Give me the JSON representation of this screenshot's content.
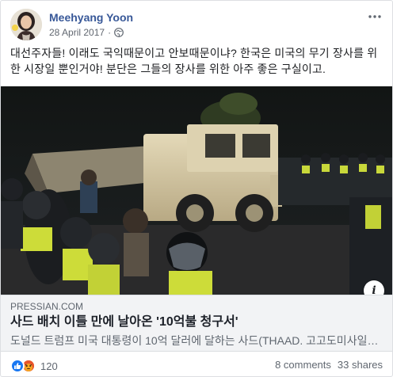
{
  "post": {
    "author": "Meehyang Yoon",
    "date": "28 April 2017",
    "separator": "·",
    "privacy_icon": "globe-icon",
    "more_icon": "ellipsis-icon",
    "text": "대선주자들! 이래도 국익때문이고 안보때문이냐? 한국은 미국의 무기 장사를 위한 시장일 뿐인거야! 분단은 그들의 장사를 위한 아주 좋은 구실이고."
  },
  "link": {
    "domain": "PRESSIAN.COM",
    "title": "사드 배치 이틀 만에 날아온 '10억불 청구서'",
    "description": "도널드 트럼프 미국 대통령이 10억 달러에 달하는 사드(THAAD. 고고도미사일방어체계) 비용을 한국이 부담해야 한다고 말했다.",
    "info_icon": "info-icon"
  },
  "footer": {
    "reaction_icons": [
      "like-icon",
      "angry-icon"
    ],
    "reaction_count": "120",
    "comments": "8 comments",
    "shares": "33 shares"
  },
  "colors": {
    "author_link": "#385898",
    "like_blue": "#1877f2",
    "angry_orange": "#f0a03a",
    "card_bg": "#f2f3f5"
  }
}
